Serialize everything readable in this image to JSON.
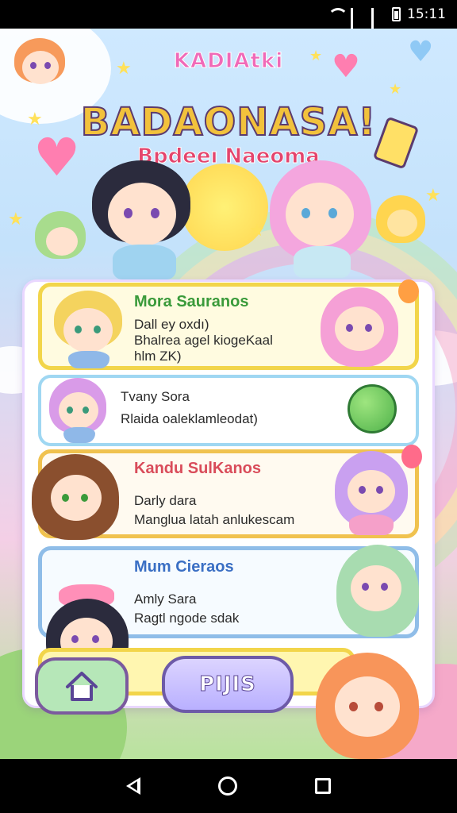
{
  "status_bar": {
    "time": "15:11"
  },
  "header": {
    "top_title": "KADIAtki",
    "main_title": "BADAONASA!",
    "subtitle": "Bpdeeı Naeoma"
  },
  "cards": [
    {
      "name": "Mora Sauranos",
      "lines": [
        "Dall ey oxdı)",
        "Bhalrea agel kiogeKaal",
        "hlm ZK)"
      ],
      "accent": "#f2d54a"
    },
    {
      "name": "Tvany Sora",
      "lines": [
        "Rlaida oaleklamleodat)"
      ],
      "accent": "#9fd7f2"
    },
    {
      "name": "Kandu SulKanos",
      "lines": [
        "Darly dara",
        "Manglua latah anlukescam"
      ],
      "accent": "#f0c24f"
    },
    {
      "name": "Mum Cieraos",
      "lines": [
        "Amly Sara",
        "Ragtl ngode sdak"
      ],
      "accent": "#8fbde8"
    }
  ],
  "buttons": {
    "home": "home",
    "plus": "PIJIS"
  },
  "colors": {
    "sky": "#c4e2fb",
    "panel_border": "#e9d7ff",
    "title_pink": "#f06ab8",
    "subtitle_red": "#e4456d"
  },
  "icons": {
    "home": "home-icon",
    "back": "back-nav-icon",
    "home_nav": "home-nav-icon",
    "recents": "recents-nav-icon"
  }
}
